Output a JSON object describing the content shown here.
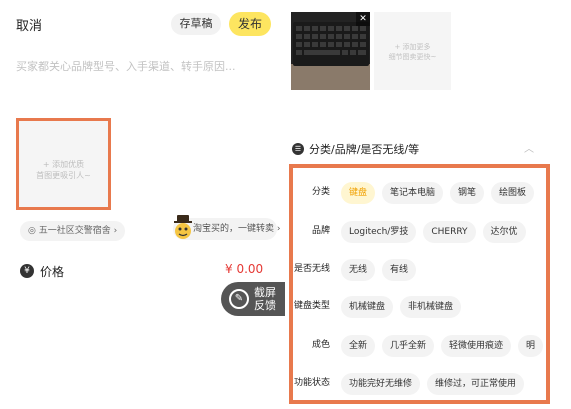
{
  "header": {
    "cancel_label": "取消",
    "draft_label": "存草稿",
    "publish_label": "发布"
  },
  "description": {
    "placeholder": "买家都关心品牌型号、入手渠道、转手原因..."
  },
  "add_photo": {
    "line1": "+ 添加优质",
    "line2": "首图更吸引人~"
  },
  "location": {
    "label": "五一社区交警宿舍"
  },
  "taobao": {
    "label": "淘宝买的，一键转卖"
  },
  "price": {
    "icon": "¥",
    "label": "价格",
    "value": "¥ 0.00"
  },
  "feedback": {
    "line1": "截屏",
    "line2": "反馈"
  },
  "photo_grid": {
    "add_more_line1": "+ 添加更多",
    "add_more_line2": "细节图卖更快~"
  },
  "category": {
    "title": "分类/品牌/是否无线/等"
  },
  "attributes": [
    {
      "label": "分类",
      "options": [
        {
          "text": "键盘",
          "selected": true
        },
        {
          "text": "笔记本电脑",
          "selected": false
        },
        {
          "text": "钢笔",
          "selected": false
        },
        {
          "text": "绘图板",
          "selected": false
        }
      ]
    },
    {
      "label": "品牌",
      "options": [
        {
          "text": "Logitech/罗技",
          "selected": false
        },
        {
          "text": "CHERRY",
          "selected": false
        },
        {
          "text": "达尔优",
          "selected": false
        }
      ]
    },
    {
      "label": "是否无线",
      "options": [
        {
          "text": "无线",
          "selected": false
        },
        {
          "text": "有线",
          "selected": false
        }
      ]
    },
    {
      "label": "键盘类型",
      "options": [
        {
          "text": "机械键盘",
          "selected": false
        },
        {
          "text": "非机械键盘",
          "selected": false
        }
      ]
    },
    {
      "label": "成色",
      "options": [
        {
          "text": "全新",
          "selected": false
        },
        {
          "text": "几乎全新",
          "selected": false
        },
        {
          "text": "轻微使用痕迹",
          "selected": false
        },
        {
          "text": "明",
          "selected": false
        }
      ]
    },
    {
      "label": "功能状态",
      "options": [
        {
          "text": "功能完好无维修",
          "selected": false
        },
        {
          "text": "维修过，可正常使用",
          "selected": false
        }
      ]
    }
  ],
  "colors": {
    "accent_yellow": "#fde560",
    "selected_text": "#f0a000",
    "price_red": "#e53935",
    "highlight_border": "#e8794d"
  }
}
